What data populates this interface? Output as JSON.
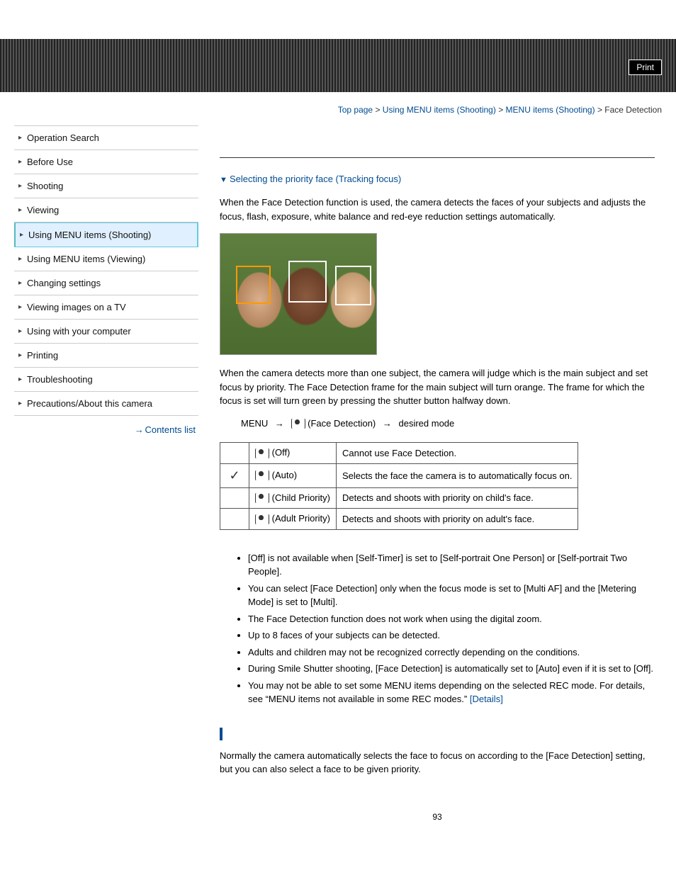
{
  "header": {
    "print_label": "Print"
  },
  "breadcrumb": {
    "top": "Top page",
    "level1": "Using MENU items (Shooting)",
    "level2": "MENU items (Shooting)",
    "current": "Face Detection"
  },
  "sidebar": {
    "items": [
      {
        "label": "Operation Search"
      },
      {
        "label": "Before Use"
      },
      {
        "label": "Shooting"
      },
      {
        "label": "Viewing"
      },
      {
        "label": "Using MENU items (Shooting)"
      },
      {
        "label": "Using MENU items (Viewing)"
      },
      {
        "label": "Changing settings"
      },
      {
        "label": "Viewing images on a TV"
      },
      {
        "label": "Using with your computer"
      },
      {
        "label": "Printing"
      },
      {
        "label": "Troubleshooting"
      },
      {
        "label": "Precautions/About this camera"
      }
    ],
    "contents_list": "Contents list"
  },
  "main": {
    "toc_link1": "Selecting the priority face (Tracking focus)",
    "intro": "When the Face Detection function is used, the camera detects the faces of your subjects and adjusts the focus, flash, exposure, white balance and red-eye reduction settings automatically.",
    "para2": "When the camera detects more than one subject, the camera will judge which is the main subject and set focus by priority. The Face Detection frame for the main subject will turn orange. The frame for which the focus is set will turn green by pressing the shutter button halfway down.",
    "steps_prefix": "MENU",
    "steps_mid": "(Face Detection)",
    "steps_suffix": "desired mode",
    "table": [
      {
        "checked": false,
        "mode": "(Off)",
        "desc": "Cannot use Face Detection."
      },
      {
        "checked": true,
        "mode": "(Auto)",
        "desc": "Selects the face the camera is to automatically focus on."
      },
      {
        "checked": false,
        "mode": "(Child Priority)",
        "desc": "Detects and shoots with priority on child's face."
      },
      {
        "checked": false,
        "mode": "(Adult Priority)",
        "desc": "Detects and shoots with priority on adult's face."
      }
    ],
    "notes": [
      "[Off] is not available when [Self-Timer] is set to [Self-portrait One Person] or [Self-portrait Two People].",
      "You can select [Face Detection] only when the focus mode is set to [Multi AF] and the [Metering Mode] is set to [Multi].",
      "The Face Detection function does not work when using the digital zoom.",
      "Up to 8 faces of your subjects can be detected.",
      "Adults and children may not be recognized correctly depending on the conditions.",
      "During Smile Shutter shooting, [Face Detection] is automatically set to [Auto] even if it is set to [Off].",
      "You may not be able to set some MENU items depending on the selected REC mode. For details, see “MENU items not available in some REC modes.” "
    ],
    "details_link": "[Details]",
    "section2_para": "Normally the camera automatically selects the face to focus on according to the [Face Detection] setting, but you can also select a face to be given priority.",
    "page_number": "93"
  }
}
